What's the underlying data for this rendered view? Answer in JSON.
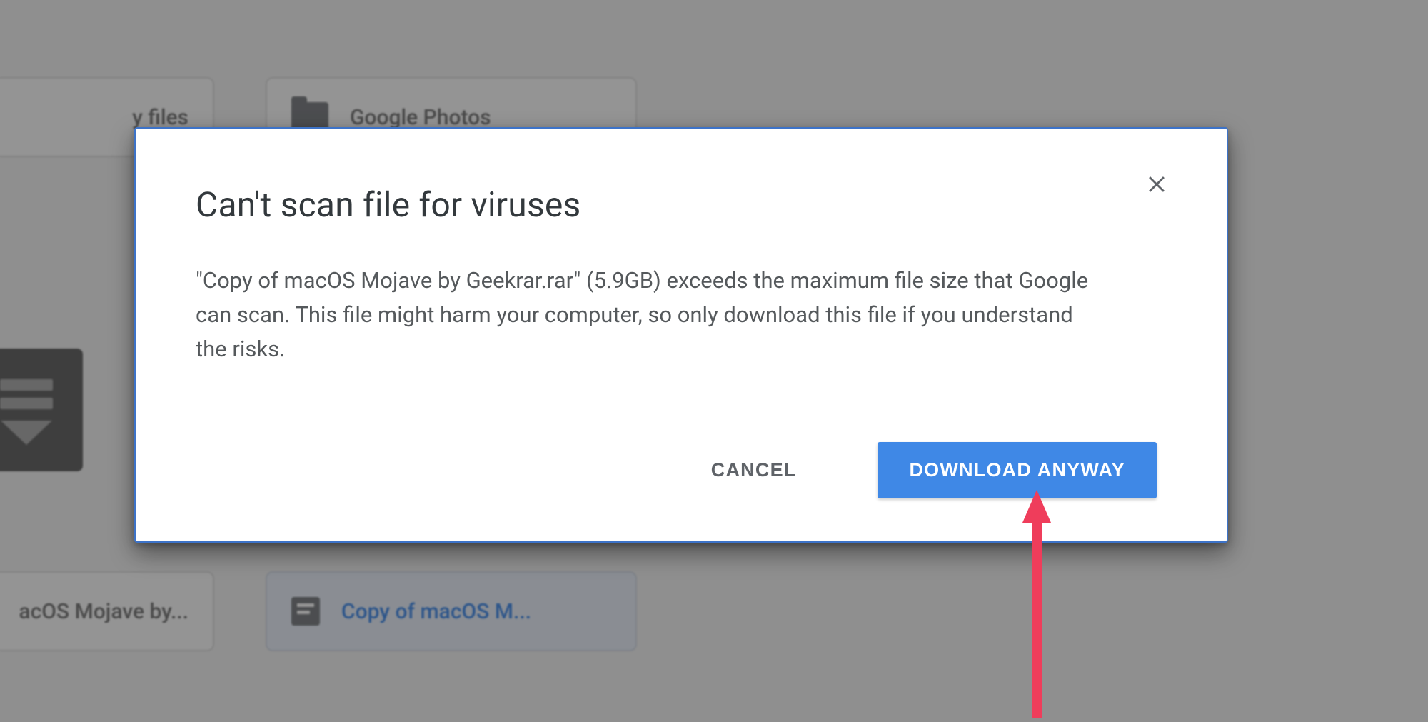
{
  "background": {
    "top_left_card_label": "y files",
    "top_right_card_label": "Google Photos",
    "bottom_left_card_label": "acOS Mojave by...",
    "bottom_right_card_label": "Copy of macOS M..."
  },
  "dialog": {
    "title": "Can't scan file for viruses",
    "body": "\"Copy of macOS Mojave by Geekrar.rar\" (5.9GB) exceeds the maximum file size that Google can scan. This file might harm your computer, so only download this file if you understand the risks.",
    "cancel_label": "CANCEL",
    "download_label": "DOWNLOAD ANYWAY"
  },
  "annotation": {
    "arrow_color": "#ef3d5b"
  }
}
